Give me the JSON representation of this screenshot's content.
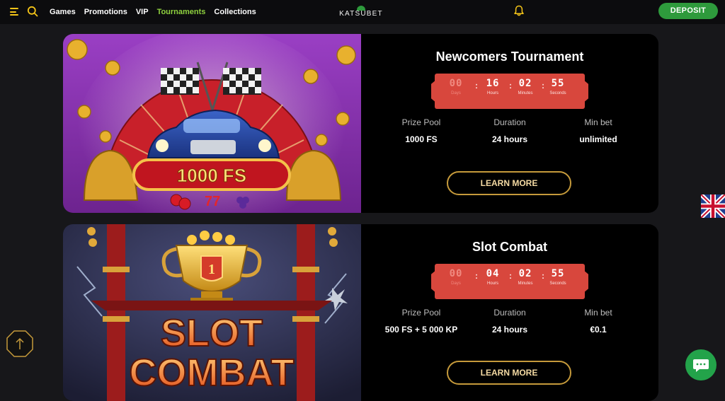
{
  "header": {
    "menu_icon": "menu-icon",
    "search_icon": "search-icon",
    "nav": [
      "Games",
      "Promotions",
      "VIP",
      "Tournaments",
      "Collections"
    ],
    "active_nav": "Tournaments",
    "logo_text": "KATSUBET",
    "bell_icon": "bell-icon",
    "deposit_label": "DEPOSIT"
  },
  "tournaments": [
    {
      "title": "Newcomers Tournament",
      "banner_text": "1000 FS",
      "timer": {
        "days": "00",
        "hours": "16",
        "minutes": "02",
        "seconds": "55",
        "labels": [
          "Days",
          "Hours",
          "Minutes",
          "Seconds"
        ]
      },
      "stats": [
        {
          "label": "Prize Pool",
          "value": "1000 FS"
        },
        {
          "label": "Duration",
          "value": "24 hours"
        },
        {
          "label": "Min bet",
          "value": "unlimited"
        }
      ],
      "cta": "LEARN MORE"
    },
    {
      "title": "Slot Combat",
      "banner_text": [
        "SLOT",
        "COMBAT"
      ],
      "trophy_rank": "1",
      "timer": {
        "days": "00",
        "hours": "04",
        "minutes": "02",
        "seconds": "55",
        "labels": [
          "Days",
          "Hours",
          "Minutes",
          "Seconds"
        ]
      },
      "stats": [
        {
          "label": "Prize Pool",
          "value": "500 FS + 5 000 KP"
        },
        {
          "label": "Duration",
          "value": "24 hours"
        },
        {
          "label": "Min bet",
          "value": "€0.1"
        }
      ],
      "cta": "LEARN MORE"
    }
  ],
  "colors": {
    "accent_green": "#2e9a3c",
    "active_nav": "#8fd13f",
    "timer_red": "#d8473d",
    "cta_border": "#c59a3b"
  },
  "floating": {
    "language_flag": "uk-flag-icon",
    "scroll_top_icon": "arrow-up-icon",
    "chat_icon": "chat-icon"
  }
}
